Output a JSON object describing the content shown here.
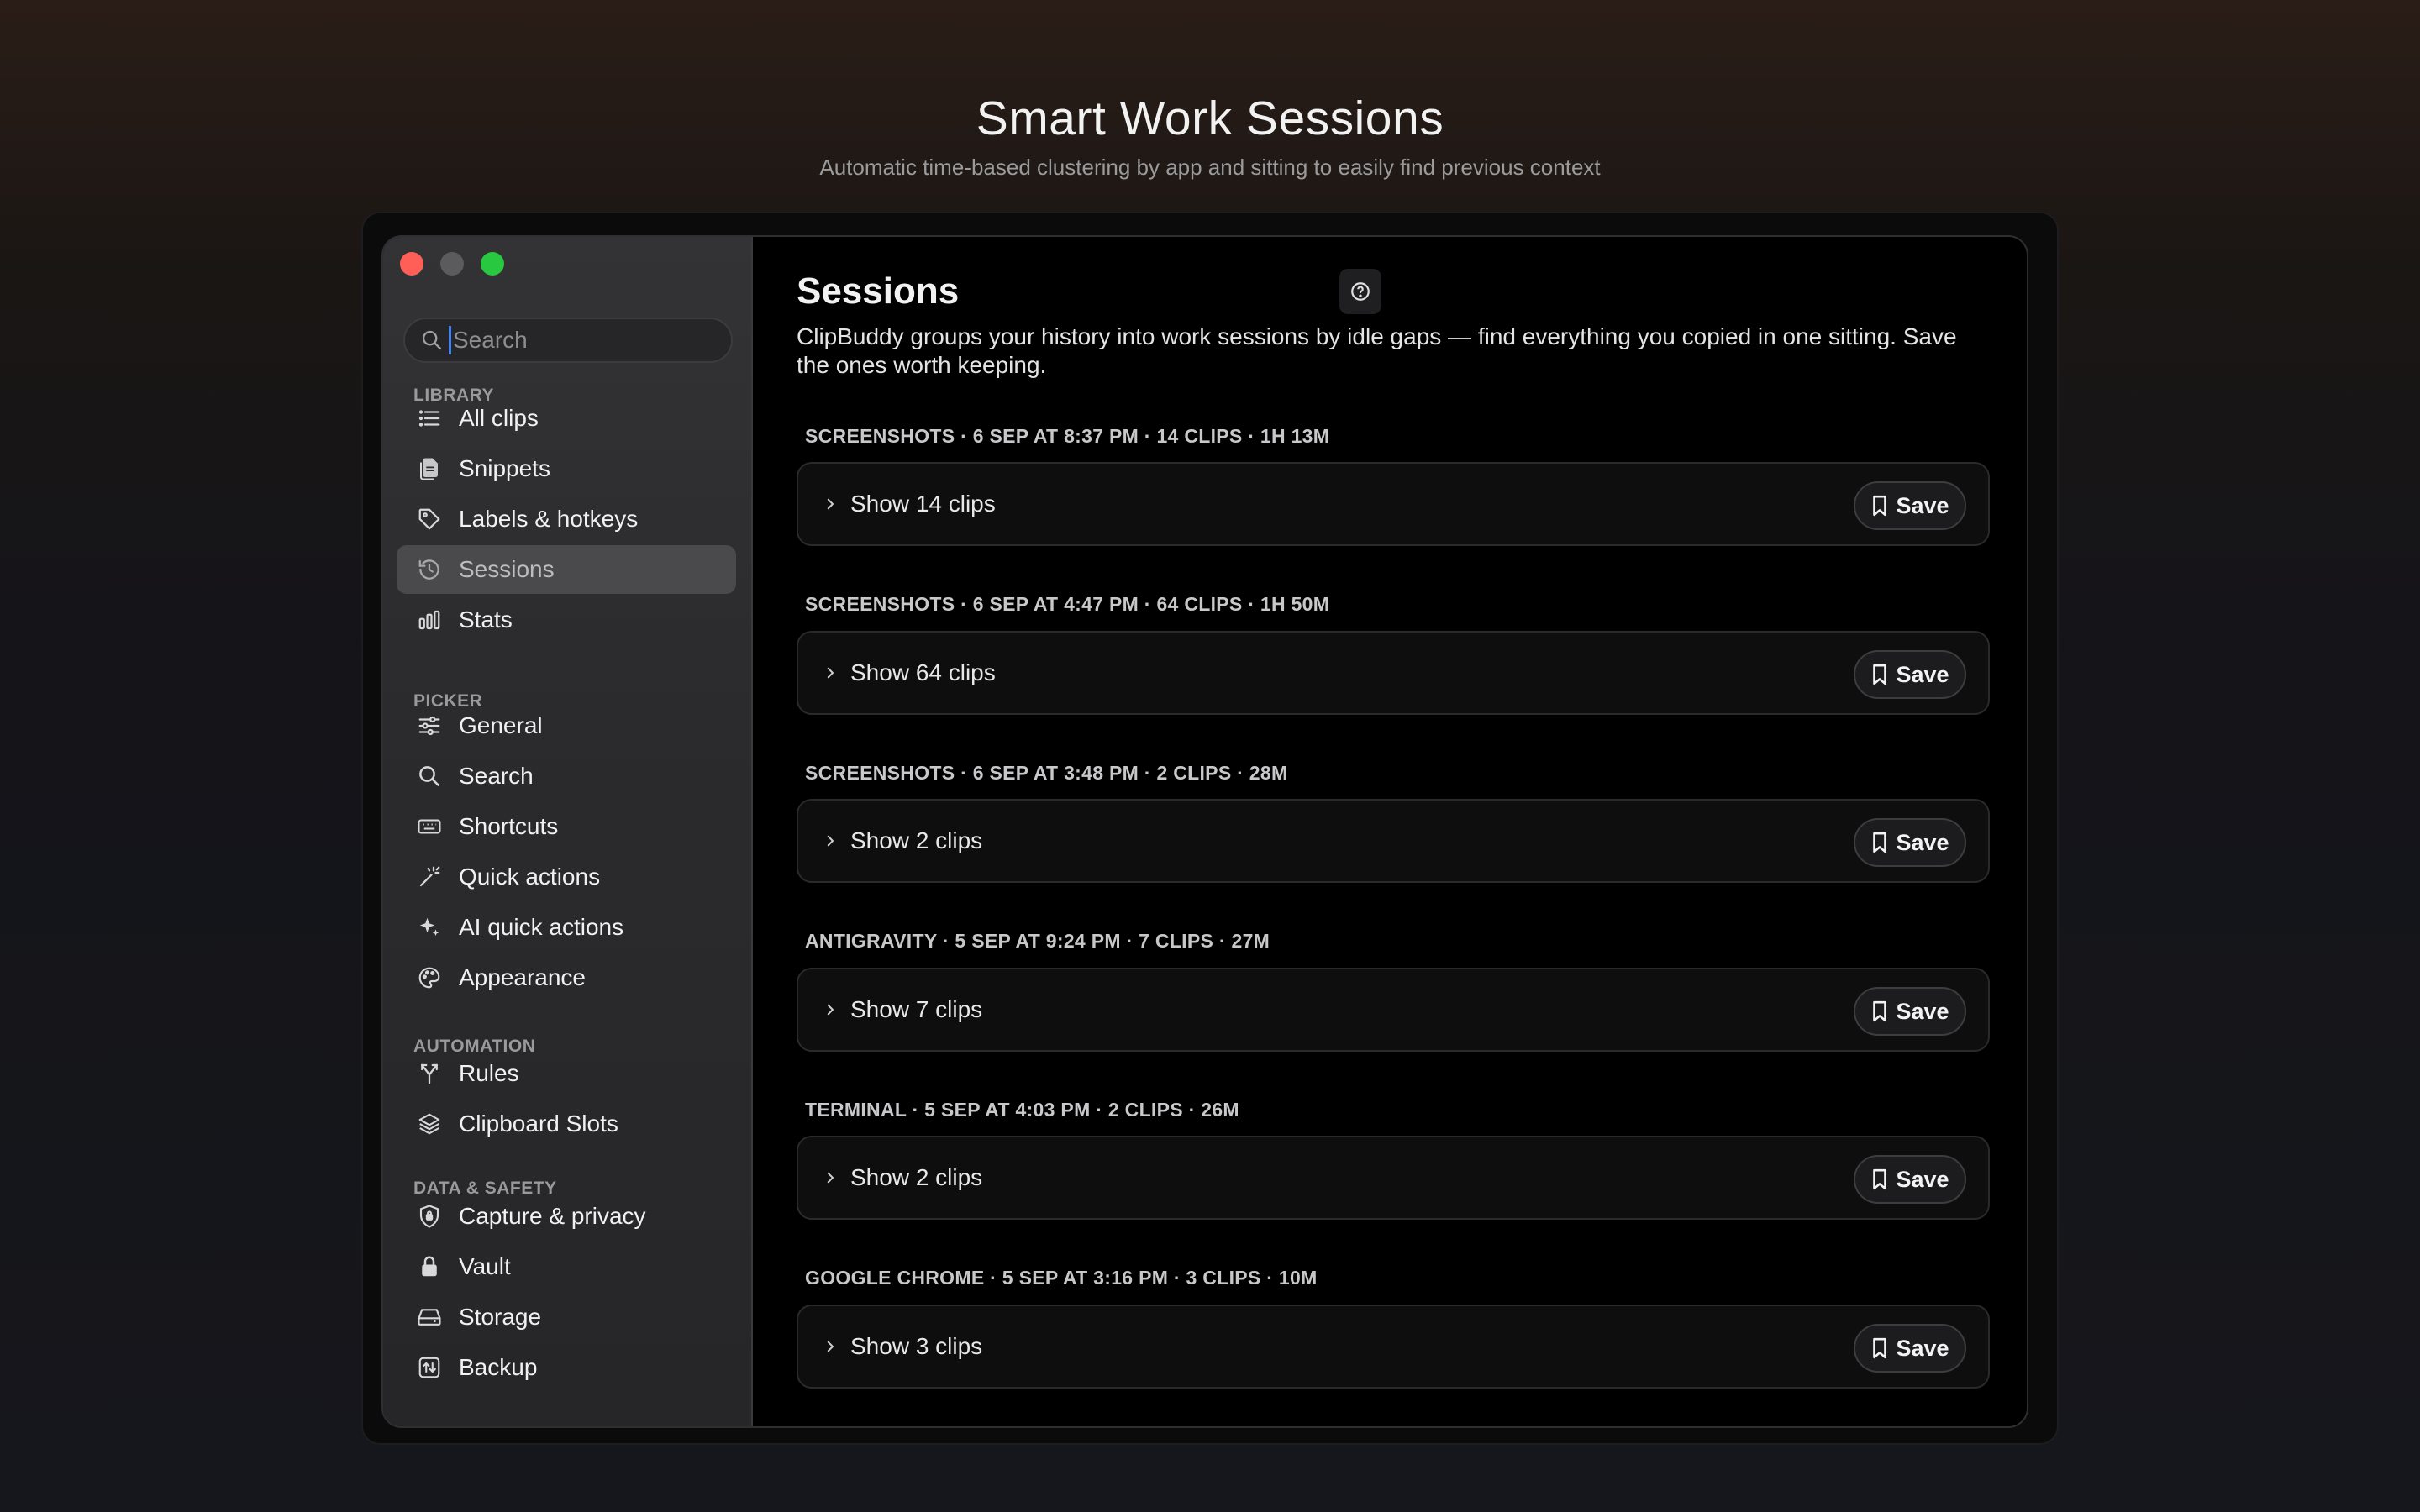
{
  "hero": {
    "title": "Smart Work Sessions",
    "subtitle": "Automatic time-based clustering by app and sitting to easily find previous context"
  },
  "sidebar": {
    "search_placeholder": "Search",
    "sections": [
      {
        "label": "LIBRARY",
        "items": [
          {
            "label": "All clips",
            "icon": "list-icon"
          },
          {
            "label": "Snippets",
            "icon": "documents-icon"
          },
          {
            "label": "Labels & hotkeys",
            "icon": "tag-icon"
          },
          {
            "label": "Sessions",
            "icon": "history-icon",
            "active": true
          },
          {
            "label": "Stats",
            "icon": "bar-chart-icon"
          }
        ]
      },
      {
        "label": "PICKER",
        "items": [
          {
            "label": "General",
            "icon": "sliders-icon"
          },
          {
            "label": "Search",
            "icon": "search-icon"
          },
          {
            "label": "Shortcuts",
            "icon": "keyboard-icon"
          },
          {
            "label": "Quick actions",
            "icon": "magic-wand-icon"
          },
          {
            "label": "AI quick actions",
            "icon": "sparkles-icon"
          },
          {
            "label": "Appearance",
            "icon": "palette-icon"
          }
        ]
      },
      {
        "label": "AUTOMATION",
        "items": [
          {
            "label": "Rules",
            "icon": "branch-icon"
          },
          {
            "label": "Clipboard Slots",
            "icon": "layers-icon"
          }
        ]
      },
      {
        "label": "DATA & SAFETY",
        "items": [
          {
            "label": "Capture & privacy",
            "icon": "shield-icon"
          },
          {
            "label": "Vault",
            "icon": "lock-icon"
          },
          {
            "label": "Storage",
            "icon": "drive-icon"
          },
          {
            "label": "Backup",
            "icon": "backup-icon"
          }
        ]
      }
    ]
  },
  "main": {
    "title": "Sessions",
    "description": "ClipBuddy groups your history into work sessions by idle gaps — find everything you copied in one sitting. Save the ones worth keeping.",
    "save_label": "Save",
    "sessions": [
      {
        "header": "SCREENSHOTS · 6 SEP AT 8:37 PM · 14 CLIPS · 1H 13M",
        "toggle": "Show 14 clips"
      },
      {
        "header": "SCREENSHOTS · 6 SEP AT 4:47 PM · 64 CLIPS · 1H 50M",
        "toggle": "Show 64 clips"
      },
      {
        "header": "SCREENSHOTS · 6 SEP AT 3:48 PM · 2 CLIPS · 28M",
        "toggle": "Show 2 clips"
      },
      {
        "header": "ANTIGRAVITY · 5 SEP AT 9:24 PM · 7 CLIPS · 27M",
        "toggle": "Show 7 clips"
      },
      {
        "header": "TERMINAL · 5 SEP AT 4:03 PM · 2 CLIPS · 26M",
        "toggle": "Show 2 clips"
      },
      {
        "header": "GOOGLE CHROME · 5 SEP AT 3:16 PM · 3 CLIPS · 10M",
        "toggle": "Show 3 clips"
      }
    ]
  }
}
